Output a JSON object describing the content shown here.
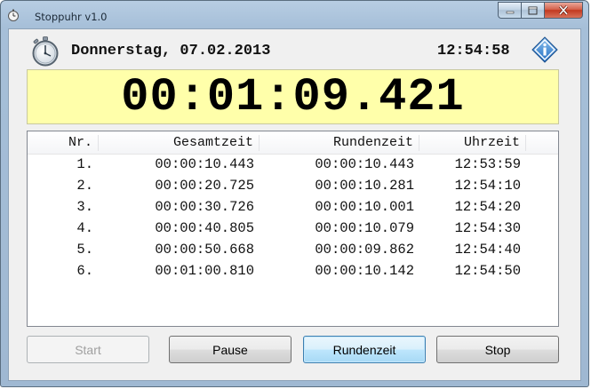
{
  "window": {
    "title": "Stoppuhr  v1.0",
    "icons": {
      "app": "stopwatch-small-icon",
      "minimize": "minimize-icon",
      "maximize": "maximize-icon",
      "close": "close-icon"
    }
  },
  "header": {
    "date": "Donnerstag, 07.02.2013",
    "clock": "12:54:58",
    "icons": {
      "left": "stopwatch-icon",
      "right": "info-icon"
    }
  },
  "timer": {
    "display": "00:01:09.421",
    "background_color": "#ffffaa"
  },
  "table": {
    "columns": [
      "Nr.",
      "Gesamtzeit",
      "Rundenzeit",
      "Uhrzeit"
    ],
    "rows": [
      [
        "1.",
        "00:00:10.443",
        "00:00:10.443",
        "12:53:59"
      ],
      [
        "2.",
        "00:00:20.725",
        "00:00:10.281",
        "12:54:10"
      ],
      [
        "3.",
        "00:00:30.726",
        "00:00:10.001",
        "12:54:20"
      ],
      [
        "4.",
        "00:00:40.805",
        "00:00:10.079",
        "12:54:30"
      ],
      [
        "5.",
        "00:00:50.668",
        "00:00:09.862",
        "12:54:40"
      ],
      [
        "6.",
        "00:01:00.810",
        "00:00:10.142",
        "12:54:50"
      ]
    ]
  },
  "buttons": {
    "start": "Start",
    "pause": "Pause",
    "rundenzeit": "Rundenzeit",
    "stop": "Stop"
  }
}
